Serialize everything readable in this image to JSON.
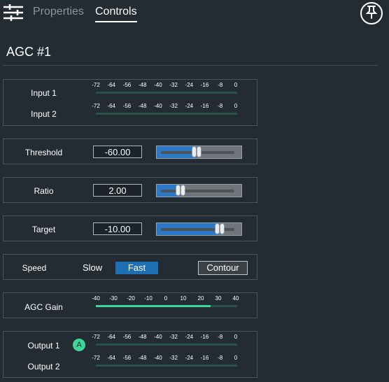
{
  "header": {
    "tabs": [
      {
        "label": "Properties",
        "active": false
      },
      {
        "label": "Controls",
        "active": true
      }
    ],
    "menu_icon": "sliders-icon",
    "pin_icon": "pin-icon"
  },
  "title": "AGC #1",
  "colors": {
    "background": "#232b33",
    "meter_fill": "#3fd59a",
    "meter_track": "#28524a",
    "slider_fill": "#2b78c6",
    "active_button": "#1f6fb3"
  },
  "input_meters": {
    "scale": [
      "-72",
      "-64",
      "-56",
      "-48",
      "-40",
      "-32",
      "-24",
      "-16",
      "-8",
      "0"
    ],
    "channels": [
      {
        "label": "Input 1",
        "level": 0
      },
      {
        "label": "Input 2",
        "level": 0
      }
    ]
  },
  "threshold": {
    "label": "Threshold",
    "value": "-60.00",
    "slider_fraction": 0.47
  },
  "ratio": {
    "label": "Ratio",
    "value": "2.00",
    "slider_fraction": 0.28
  },
  "target": {
    "label": "Target",
    "value": "-10.00",
    "slider_fraction": 0.74
  },
  "speed": {
    "label": "Speed",
    "options": [
      "Slow",
      "Fast"
    ],
    "selected": "Fast",
    "contour_label": "Contour"
  },
  "agc_gain": {
    "label": "AGC Gain",
    "scale": [
      "-40",
      "-30",
      "-20",
      "-10",
      "0",
      "10",
      "20",
      "30",
      "40"
    ],
    "level_fraction": 0.81
  },
  "output_meters": {
    "scale": [
      "-72",
      "-64",
      "-56",
      "-48",
      "-40",
      "-32",
      "-24",
      "-16",
      "-8",
      "0"
    ],
    "badge": "A",
    "channels": [
      {
        "label": "Output 1",
        "level": 0
      },
      {
        "label": "Output 2",
        "level": 0
      }
    ]
  }
}
